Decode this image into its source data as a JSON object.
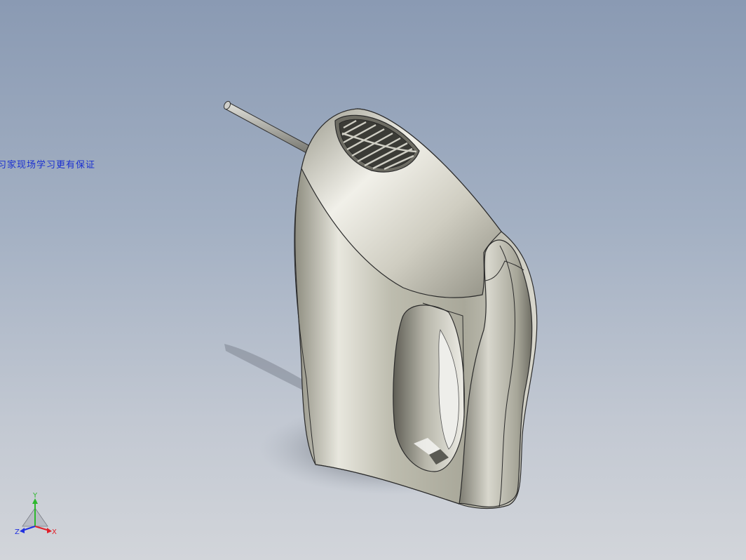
{
  "watermark": {
    "text": "习家现场学习更有保证"
  },
  "triad": {
    "x_label": "X",
    "y_label": "Y",
    "z_label": "Z",
    "x_color": "#e0202a",
    "y_color": "#2db82d",
    "z_color": "#2030e0"
  },
  "colors": {
    "background_top": "#8a9ab3",
    "background_bottom": "#d2d5da",
    "model_body": "#c4c3b5",
    "model_edge": "#2b2b2b"
  }
}
